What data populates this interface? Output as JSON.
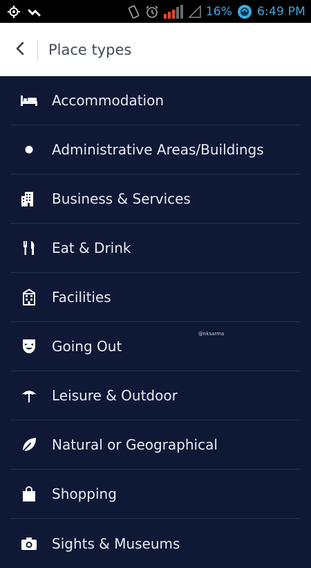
{
  "status_bar": {
    "battery_percent": "16%",
    "time": "6:49 PM",
    "icons": [
      "location-icon",
      "signal-wave-icon",
      "vibrate-icon",
      "alarm-icon",
      "cell-signal-icon",
      "no-signal-icon",
      "battery-icon"
    ]
  },
  "app_bar": {
    "back_icon": "chevron-left-icon",
    "title": "Place types"
  },
  "list": {
    "items": [
      {
        "label": "Accommodation",
        "icon": "bed-icon"
      },
      {
        "label": "Administrative Areas/Buildings",
        "icon": "dot-icon"
      },
      {
        "label": "Business & Services",
        "icon": "building-icon"
      },
      {
        "label": "Eat & Drink",
        "icon": "fork-knife-icon"
      },
      {
        "label": "Facilities",
        "icon": "facility-building-icon"
      },
      {
        "label": "Going Out",
        "icon": "mask-icon"
      },
      {
        "label": "Leisure & Outdoor",
        "icon": "umbrella-icon"
      },
      {
        "label": "Natural or Geographical",
        "icon": "leaf-icon"
      },
      {
        "label": "Shopping",
        "icon": "shopping-bag-icon"
      },
      {
        "label": "Sights & Museums",
        "icon": "camera-icon"
      }
    ]
  },
  "watermark": "@nksarma",
  "colors": {
    "background": "#0f1835",
    "appbar": "#ffffff",
    "status_accent": "#3fa9e0",
    "text": "#e9ecf3"
  }
}
